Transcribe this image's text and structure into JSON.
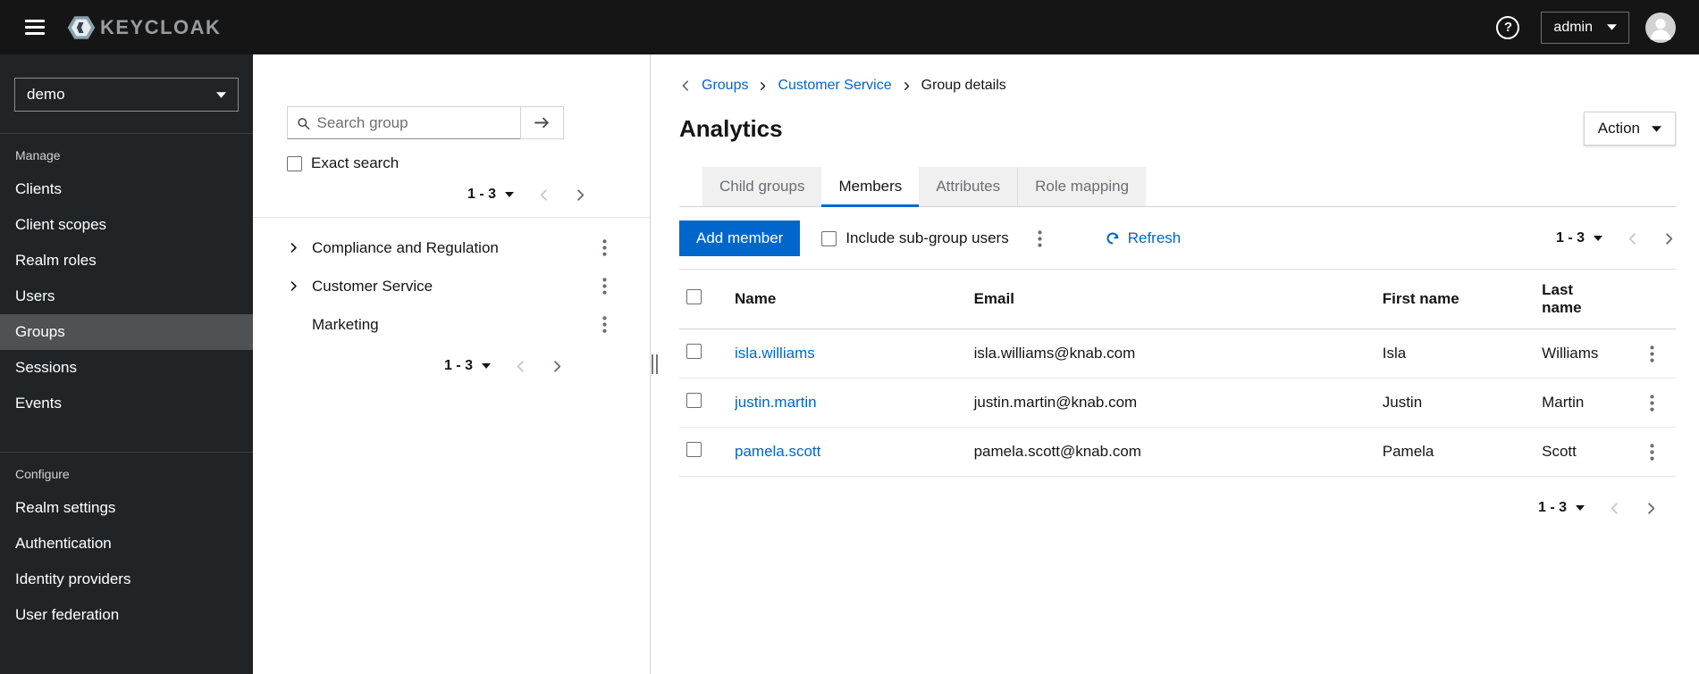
{
  "masthead": {
    "brand_text": "KEYCLOAK",
    "help_icon": "?",
    "user_menu": {
      "label": "admin"
    }
  },
  "sidebar": {
    "realm_selector": {
      "value": "demo"
    },
    "active_item": "Groups",
    "sections": [
      {
        "title": "Manage",
        "items": [
          "Clients",
          "Client scopes",
          "Realm roles",
          "Users",
          "Groups",
          "Sessions",
          "Events"
        ]
      },
      {
        "title": "Configure",
        "items": [
          "Realm settings",
          "Authentication",
          "Identity providers",
          "User federation"
        ]
      }
    ]
  },
  "groups_panel": {
    "search": {
      "placeholder": "Search group",
      "value": ""
    },
    "exact_search_label": "Exact search",
    "pagination": {
      "range": "1 - 3"
    },
    "tree": [
      {
        "label": "Compliance and Regulation",
        "expandable": true
      },
      {
        "label": "Customer Service",
        "expandable": true
      },
      {
        "label": "Marketing",
        "expandable": false
      }
    ],
    "pagination_bottom": {
      "range": "1 - 3"
    }
  },
  "main": {
    "breadcrumb": {
      "items": [
        {
          "label": "Groups",
          "link": true
        },
        {
          "label": "Customer Service",
          "link": true
        },
        {
          "label": "Group details",
          "link": false
        }
      ]
    },
    "page_title": "Analytics",
    "action_button_label": "Action",
    "tabs": [
      {
        "label": "Child groups",
        "active": false
      },
      {
        "label": "Members",
        "active": true
      },
      {
        "label": "Attributes",
        "active": false
      },
      {
        "label": "Role mapping",
        "active": false
      }
    ],
    "toolbar": {
      "add_member_label": "Add member",
      "include_subgroup_label": "Include sub-group users",
      "refresh_label": "Refresh",
      "pagination": {
        "range": "1 - 3"
      }
    },
    "table": {
      "headers": {
        "name": "Name",
        "email": "Email",
        "first_name": "First name",
        "last_name": "Last name"
      },
      "rows": [
        {
          "name": "isla.williams",
          "email": "isla.williams@knab.com",
          "first_name": "Isla",
          "last_name": "Williams"
        },
        {
          "name": "justin.martin",
          "email": "justin.martin@knab.com",
          "first_name": "Justin",
          "last_name": "Martin"
        },
        {
          "name": "pamela.scott",
          "email": "pamela.scott@knab.com",
          "first_name": "Pamela",
          "last_name": "Scott"
        }
      ]
    },
    "pagination_bottom": {
      "range": "1 - 3"
    }
  },
  "icons": {
    "hamburger-icon": "three-bars",
    "help-icon": "question-circle",
    "caret-down-icon": "solid-triangle-down",
    "avatar-icon": "person-circle",
    "search-icon": "magnifier",
    "arrow-right-icon": "long-arrow-right",
    "angle-left-icon": "chevron-left",
    "angle-right-icon": "chevron-right",
    "kebab-icon": "vertical-dots",
    "refresh-icon": "circular-arrow",
    "grip-icon": "vertical-grip"
  },
  "colors": {
    "primary": "#0066cc",
    "link": "#0066cc",
    "masthead_bg": "#151515",
    "sidebar_bg": "#212427",
    "sidebar_active_bg": "#4f5255",
    "tab_inactive_bg": "#f0f0f0",
    "border": "#d2d2d2"
  }
}
